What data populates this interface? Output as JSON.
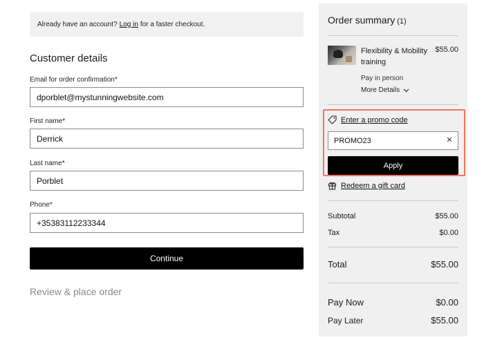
{
  "banner": {
    "prefix": "Already have an account?",
    "login_link": "Log in",
    "suffix": "for a faster checkout."
  },
  "customer": {
    "title": "Customer details",
    "email_label": "Email for order confirmation*",
    "email_value": "dporblet@mystunningwebsite.com",
    "first_name_label": "First name*",
    "first_name_value": "Derrick",
    "last_name_label": "Last name*",
    "last_name_value": "Porblet",
    "phone_label": "Phone*",
    "phone_value": "+35383112233344",
    "continue_label": "Continue"
  },
  "review": {
    "title": "Review & place order"
  },
  "summary": {
    "title": "Order summary",
    "count": "(1)",
    "item": {
      "name": "Flexibility & Mobility training",
      "price": "$55.00",
      "payment": "Pay in person",
      "more_details": "More Details"
    },
    "promo": {
      "link": "Enter a promo code",
      "value": "PROMO23",
      "apply_label": "Apply"
    },
    "gift_card_link": "Redeem a gift card",
    "subtotal_label": "Subtotal",
    "subtotal_value": "$55.00",
    "tax_label": "Tax",
    "tax_value": "$0.00",
    "total_label": "Total",
    "total_value": "$55.00",
    "pay_now_label": "Pay Now",
    "pay_now_value": "$0.00",
    "pay_later_label": "Pay Later",
    "pay_later_value": "$55.00"
  },
  "icons": {
    "tag": "tag-icon",
    "gift": "gift-icon",
    "chevron": "chevron-down-icon",
    "clear": "close-icon"
  },
  "colors": {
    "highlight_border": "#ee7661",
    "button_bg": "#000000",
    "panel_bg": "#f0f0f0"
  }
}
